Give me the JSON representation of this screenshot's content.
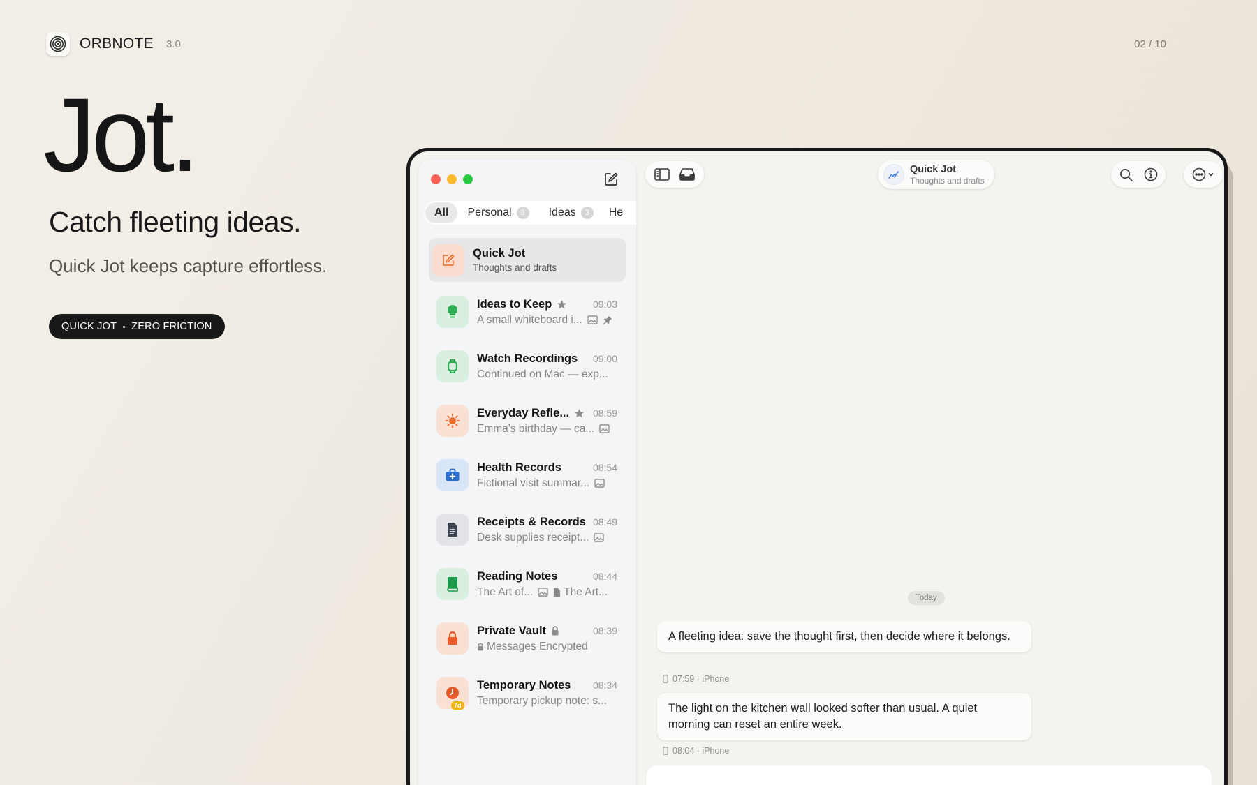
{
  "brand": {
    "name": "ORBNOTE",
    "version": "3.0"
  },
  "pager": "02 / 10",
  "hero": {
    "title": "Jot.",
    "subtitle": "Catch fleeting ideas.",
    "description": "Quick Jot keeps capture effortless.",
    "pill_left": "QUICK JOT",
    "pill_right": "ZERO FRICTION"
  },
  "colors": {
    "accent_dark": "#181818",
    "traffic_red": "#fe5f57",
    "traffic_yellow": "#febc2e",
    "traffic_green": "#28c840"
  },
  "sidebar": {
    "tabs": [
      {
        "label": "All"
      },
      {
        "label": "Personal",
        "badge": "3"
      },
      {
        "label": "Ideas",
        "badge": "3"
      },
      {
        "label": "He"
      }
    ],
    "items": [
      {
        "title": "Quick Jot",
        "preview": "Thoughts and drafts",
        "icon": "compose-icon"
      },
      {
        "title": "Ideas to Keep",
        "time": "09:03",
        "preview": "A small whiteboard i...",
        "icon": "lightbulb-icon"
      },
      {
        "title": "Watch Recordings",
        "time": "09:00",
        "preview": "Continued on Mac — exp...",
        "icon": "watch-icon"
      },
      {
        "title": "Everyday Refle...",
        "time": "08:59",
        "preview": "Emma's birthday — ca...",
        "icon": "sun-icon"
      },
      {
        "title": "Health Records",
        "time": "08:54",
        "preview": "Fictional visit summar...",
        "icon": "medical-kit-icon"
      },
      {
        "title": "Receipts & Records",
        "time": "08:49",
        "preview": "Desk supplies receipt...",
        "icon": "document-icon"
      },
      {
        "title": "Reading Notes",
        "time": "08:44",
        "preview": "The Art of...",
        "preview_extra": "The Art...",
        "icon": "book-icon"
      },
      {
        "title": "Private Vault",
        "time": "08:39",
        "preview": "Messages Encrypted",
        "icon": "lock-icon"
      },
      {
        "title": "Temporary Notes",
        "time": "08:34",
        "preview": "Temporary pickup note: s...",
        "badge": "7d",
        "icon": "timer-icon"
      }
    ]
  },
  "chat": {
    "title": "Quick Jot",
    "subtitle": "Thoughts and drafts",
    "day": "Today",
    "messages": [
      {
        "text": "A fleeting idea: save the thought first, then decide where it belongs.",
        "meta": "07:59 · iPhone"
      },
      {
        "text": "The light on the kitchen wall looked softer than usual. A quiet morning can reset an entire week.",
        "meta": "08:04 · iPhone"
      }
    ]
  }
}
